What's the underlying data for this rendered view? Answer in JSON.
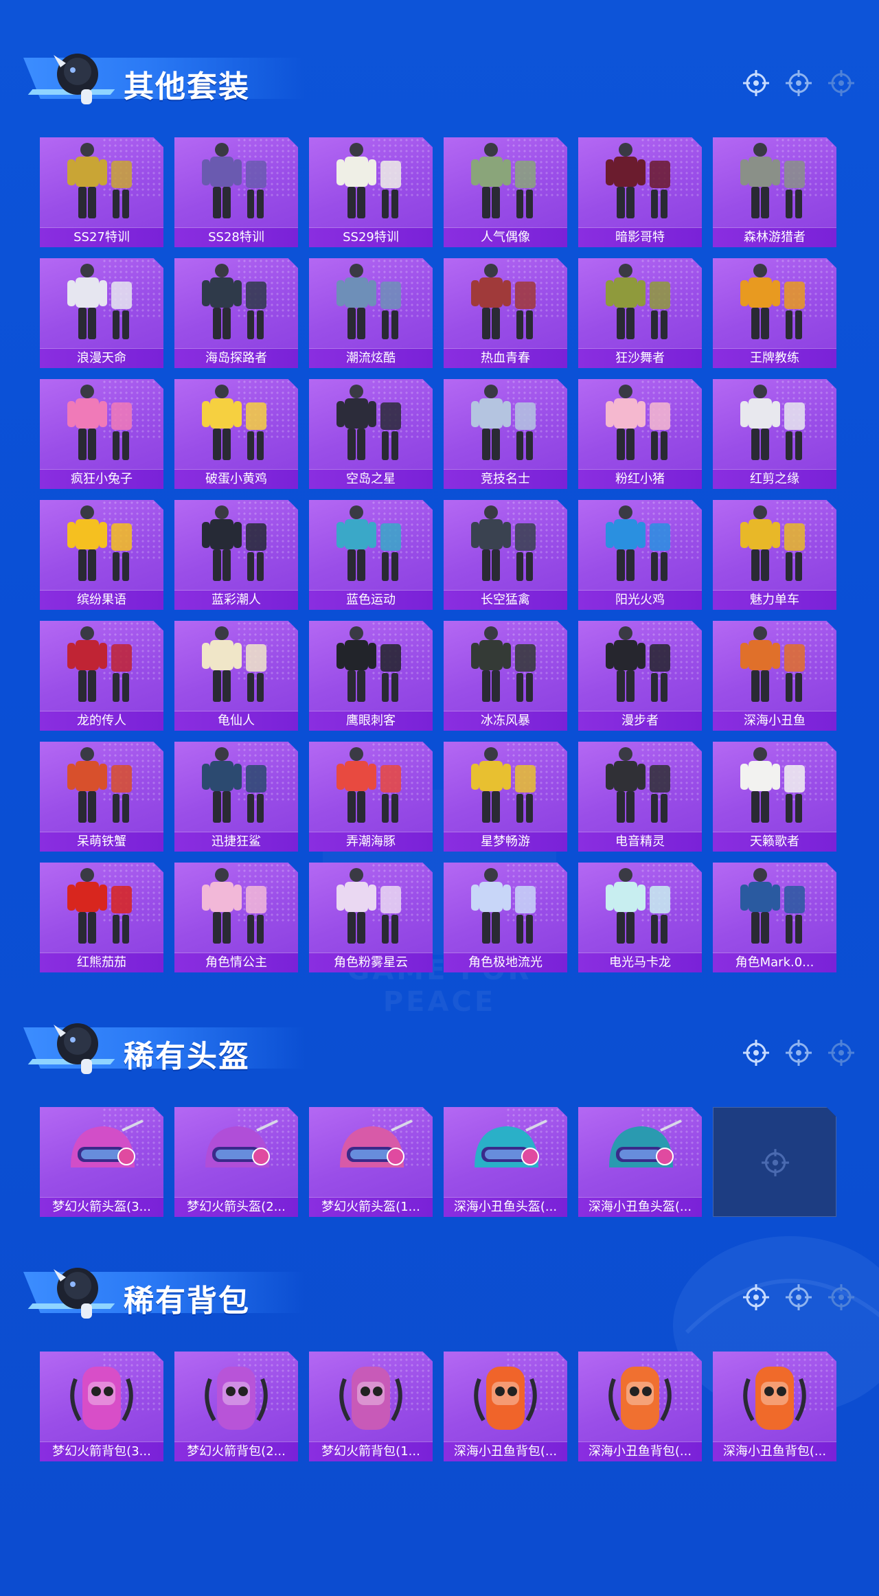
{
  "sections": [
    {
      "title": "其他套装",
      "items": [
        {
          "label": "SS27特训",
          "color": "#c9a535",
          "type": "suit"
        },
        {
          "label": "SS28特训",
          "color": "#6a5ab0",
          "type": "suit"
        },
        {
          "label": "SS29特训",
          "color": "#efefe6",
          "type": "suit"
        },
        {
          "label": "人气偶像",
          "color": "#8aa57a",
          "type": "suit"
        },
        {
          "label": "暗影哥特",
          "color": "#6b1c2e",
          "type": "suit"
        },
        {
          "label": "森林游猎者",
          "color": "#8a9088",
          "type": "suit"
        },
        {
          "label": "浪漫天命",
          "color": "#e6e6f0",
          "type": "suit"
        },
        {
          "label": "海岛探路者",
          "color": "#2f3a4a",
          "type": "suit"
        },
        {
          "label": "潮流炫酷",
          "color": "#6e8fb8",
          "type": "suit"
        },
        {
          "label": "热血青春",
          "color": "#a03a3a",
          "type": "suit"
        },
        {
          "label": "狂沙舞者",
          "color": "#8f9a3c",
          "type": "suit"
        },
        {
          "label": "王牌教练",
          "color": "#e89a20",
          "type": "suit"
        },
        {
          "label": "疯狂小兔子",
          "color": "#f07ab8",
          "type": "suit"
        },
        {
          "label": "破蛋小黄鸡",
          "color": "#f6d040",
          "type": "suit"
        },
        {
          "label": "空岛之星",
          "color": "#2c2c3a",
          "type": "suit"
        },
        {
          "label": "竞技名士",
          "color": "#b4c4e0",
          "type": "suit"
        },
        {
          "label": "粉红小猪",
          "color": "#f5b8cf",
          "type": "suit"
        },
        {
          "label": "红剪之缘",
          "color": "#e8e8ee",
          "type": "suit"
        },
        {
          "label": "缤纷果语",
          "color": "#f5c020",
          "type": "suit"
        },
        {
          "label": "蓝彩潮人",
          "color": "#262a36",
          "type": "suit"
        },
        {
          "label": "蓝色运动",
          "color": "#3aa8c8",
          "type": "suit"
        },
        {
          "label": "长空猛禽",
          "color": "#3a4250",
          "type": "suit"
        },
        {
          "label": "阳光火鸡",
          "color": "#2a90e0",
          "type": "suit"
        },
        {
          "label": "魅力单车",
          "color": "#e8b828",
          "type": "suit"
        },
        {
          "label": "龙的传人",
          "color": "#c02434",
          "type": "suit"
        },
        {
          "label": "龟仙人",
          "color": "#f0e6c8",
          "type": "suit"
        },
        {
          "label": "鹰眼刺客",
          "color": "#22242a",
          "type": "suit"
        },
        {
          "label": "冰冻风暴",
          "color": "#343a36",
          "type": "suit"
        },
        {
          "label": "漫步者",
          "color": "#26262e",
          "type": "suit"
        },
        {
          "label": "深海小丑鱼",
          "color": "#e0702a",
          "type": "suit"
        },
        {
          "label": "呆萌铁蟹",
          "color": "#d8502c",
          "type": "suit"
        },
        {
          "label": "迅捷狂鲨",
          "color": "#2c4a70",
          "type": "suit"
        },
        {
          "label": "弄潮海豚",
          "color": "#e84a40",
          "type": "suit"
        },
        {
          "label": "星梦畅游",
          "color": "#e8c030",
          "type": "suit"
        },
        {
          "label": "电音精灵",
          "color": "#303036",
          "type": "suit"
        },
        {
          "label": "天籁歌者",
          "color": "#f2f2f0",
          "type": "suit"
        },
        {
          "label": "红熊茄茄",
          "color": "#d8261e",
          "type": "suit"
        },
        {
          "label": "角色情公主",
          "color": "#f2b8d8",
          "type": "suit"
        },
        {
          "label": "角色粉雾星云",
          "color": "#ead8f2",
          "type": "suit"
        },
        {
          "label": "角色极地流光",
          "color": "#c8d6f8",
          "type": "suit"
        },
        {
          "label": "电光马卡龙",
          "color": "#c8eef0",
          "type": "suit"
        },
        {
          "label": "角色Mark.0...",
          "color": "#2a5aa0",
          "type": "suit"
        }
      ]
    },
    {
      "title": "稀有头盔",
      "items": [
        {
          "label": "梦幻火箭头盔(3...",
          "color": "#d24ec8",
          "type": "helmet"
        },
        {
          "label": "梦幻火箭头盔(2...",
          "color": "#b04ed8",
          "type": "helmet"
        },
        {
          "label": "梦幻火箭头盔(1...",
          "color": "#d85aa8",
          "type": "helmet"
        },
        {
          "label": "深海小丑鱼头盔(...",
          "color": "#2ab0c8",
          "type": "helmet"
        },
        {
          "label": "深海小丑鱼头盔(...",
          "color": "#2a9ab0",
          "type": "helmet"
        }
      ],
      "empty_slots": 1
    },
    {
      "title": "稀有背包",
      "items": [
        {
          "label": "梦幻火箭背包(3...",
          "color": "#d84ec8",
          "type": "backpack"
        },
        {
          "label": "梦幻火箭背包(2...",
          "color": "#b854d8",
          "type": "backpack"
        },
        {
          "label": "梦幻火箭背包(1...",
          "color": "#c85ab8",
          "type": "backpack"
        },
        {
          "label": "深海小丑鱼背包(...",
          "color": "#f0642a",
          "type": "backpack"
        },
        {
          "label": "深海小丑鱼背包(...",
          "color": "#f07030",
          "type": "backpack"
        },
        {
          "label": "深海小丑鱼背包(...",
          "color": "#f06a2a",
          "type": "backpack"
        }
      ]
    }
  ],
  "watermark": "GAME FOR PEACE"
}
